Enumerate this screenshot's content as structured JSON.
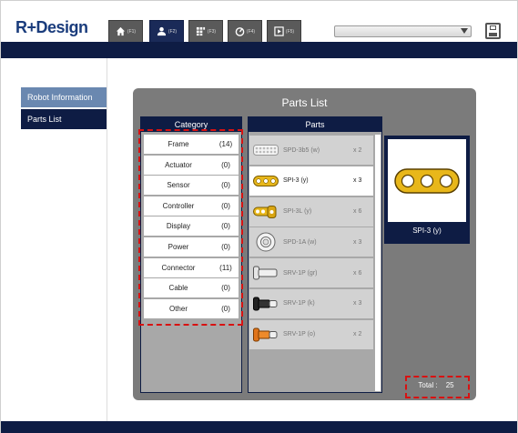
{
  "app": {
    "logo_text": "R+Design"
  },
  "tabs": [
    {
      "key": "(F1)",
      "icon": "home-icon",
      "active": false
    },
    {
      "key": "(F2)",
      "icon": "user-icon",
      "active": true
    },
    {
      "key": "(F3)",
      "icon": "grid-icon",
      "active": false
    },
    {
      "key": "(F4)",
      "icon": "gauge-icon",
      "active": false
    },
    {
      "key": "(F5)",
      "icon": "play-icon",
      "active": false
    }
  ],
  "sidebar": {
    "items": [
      {
        "label": "Robot Information",
        "active": false
      },
      {
        "label": "Parts List",
        "active": true
      }
    ]
  },
  "panel": {
    "title": "Parts List"
  },
  "category": {
    "header": "Category",
    "rows": [
      {
        "name": "Frame",
        "count": "(14)"
      },
      {
        "name": "Actuator",
        "count": "(0)"
      },
      {
        "name": "Sensor",
        "count": "(0)"
      },
      {
        "name": "Controller",
        "count": "(0)"
      },
      {
        "name": "Display",
        "count": "(0)"
      },
      {
        "name": "Power",
        "count": "(0)"
      },
      {
        "name": "Connector",
        "count": "(11)"
      },
      {
        "name": "Cable",
        "count": "(0)"
      },
      {
        "name": "Other",
        "count": "(0)"
      }
    ]
  },
  "parts": {
    "header": "Parts",
    "rows": [
      {
        "name": "SPD-3b5 (w)",
        "qty": "x 2",
        "selected": false,
        "icon": "plate-icon"
      },
      {
        "name": "SPI-3 (y)",
        "qty": "x 3",
        "selected": true,
        "icon": "link-bracket-icon"
      },
      {
        "name": "SPI-3L (y)",
        "qty": "x 6",
        "selected": false,
        "icon": "l-bracket-icon"
      },
      {
        "name": "SPD-1A (w)",
        "qty": "x 3",
        "selected": false,
        "icon": "washer-icon"
      },
      {
        "name": "SRV-1P (gr)",
        "qty": "x 6",
        "selected": false,
        "icon": "rivet-icon"
      },
      {
        "name": "SRV-1P (k)",
        "qty": "x 3",
        "selected": false,
        "icon": "rivet-icon"
      },
      {
        "name": "SRV-1P (o)",
        "qty": "x 2",
        "selected": false,
        "icon": "rivet-icon"
      }
    ]
  },
  "preview": {
    "name": "SPI-3 (y)"
  },
  "total": {
    "label": "Total :",
    "value": "25"
  },
  "colors": {
    "navy": "#0e1c44",
    "panel_gray": "#7b7b7b",
    "highlight_red": "#d81111",
    "part_yellow": "#e8b71a"
  }
}
